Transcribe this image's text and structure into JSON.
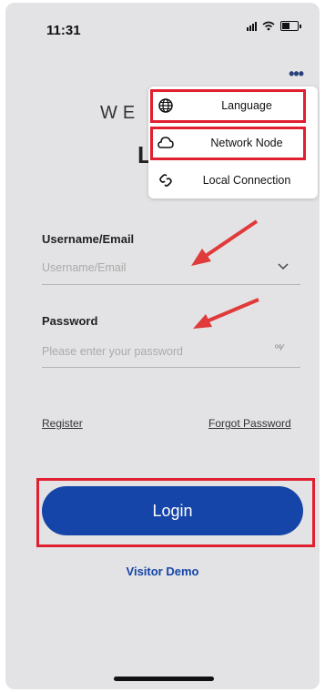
{
  "status": {
    "time": "11:31"
  },
  "header": {
    "welcome_partial": "WE",
    "login_partial": "L"
  },
  "menu": {
    "items": [
      {
        "label": "Language",
        "icon": "globe-icon"
      },
      {
        "label": "Network Node",
        "icon": "cloud-icon"
      },
      {
        "label": "Local Connection",
        "icon": "link-icon"
      }
    ]
  },
  "form": {
    "username_label": "Username/Email",
    "username_placeholder": "Username/Email",
    "password_label": "Password",
    "password_placeholder": "Please enter your password"
  },
  "links": {
    "register": "Register",
    "forgot": "Forgot Password"
  },
  "buttons": {
    "login": "Login",
    "visitor_demo": "Visitor Demo"
  },
  "colors": {
    "accent": "#1545a8",
    "highlight": "#e02030",
    "background": "#e3e3e5"
  }
}
